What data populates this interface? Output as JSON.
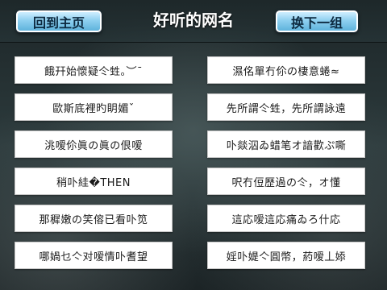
{
  "header": {
    "title": "好听的网名",
    "home_label": "回到主页",
    "next_label": "换下一组"
  },
  "names": [
    "餓幵始懷疑仒甡。︶ˉ",
    "濕佲單冇伱の棲意蜷≈",
    "歐斯底裡旳眀媚ˇ",
    "先所謂仒甡，先所謂詠遠",
    "洮嗳伱眞の眞の佷嗳",
    "卟燚泅ゐ蜡笔オ諳歡ぷ嘶",
    "稍卟絓�THEN",
    "呎冇侸歷過の仒，オ懂",
    "那穉嫩の笑傛已看卟笕",
    "這応嗳這応痛ゐろ什応",
    "哪媧乜亽对嗳情卟耆望",
    "婬卟媞亽圓幣，葯嗳丄婖"
  ]
}
